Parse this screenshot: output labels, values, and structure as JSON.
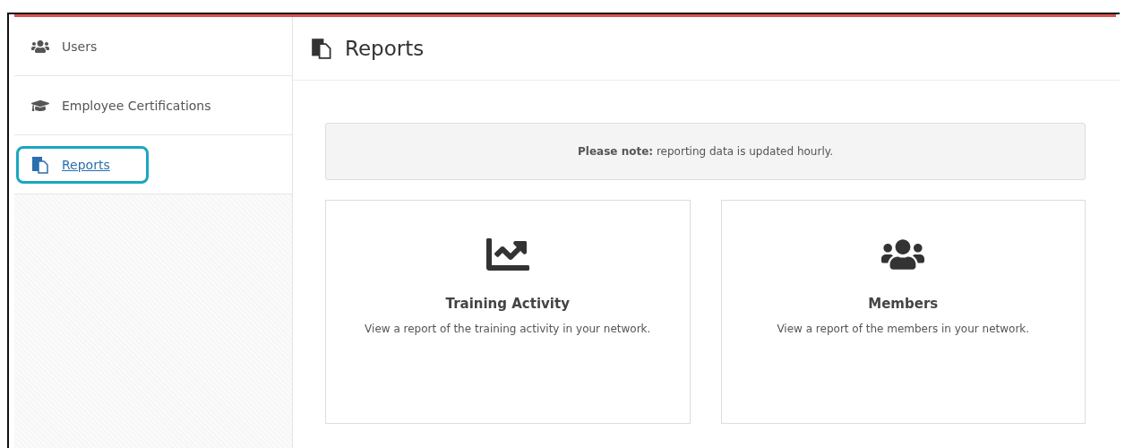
{
  "sidebar": {
    "items": [
      {
        "label": "Users",
        "kind": "users",
        "selected": false
      },
      {
        "label": "Employee Certifications",
        "kind": "cap",
        "selected": false
      },
      {
        "label": "Reports",
        "kind": "report",
        "selected": true
      }
    ]
  },
  "header": {
    "title": "Reports"
  },
  "notice": "**Please note:** reporting data is updated hourly.",
  "cards": [
    {
      "kind": "chart",
      "title": "Training Activity",
      "description": "View a report of the training activity in your network."
    },
    {
      "kind": "users",
      "title": "Members",
      "description": "View a report of the members in your network."
    }
  ]
}
